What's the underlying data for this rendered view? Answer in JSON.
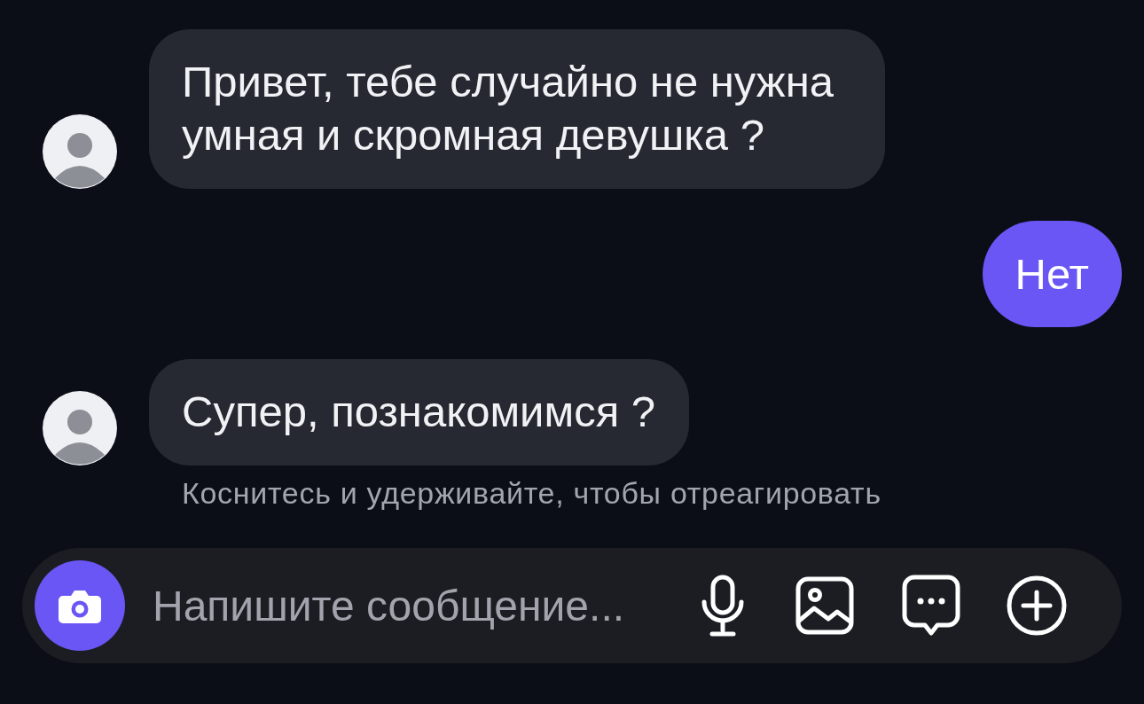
{
  "messages": [
    {
      "kind": "incoming",
      "text": "Привет, тебе случайно не нужна умная и скромная девушка ?"
    },
    {
      "kind": "outgoing",
      "text": "Нет"
    },
    {
      "kind": "incoming",
      "text": "Супер, познакомимся ?",
      "hint": "Коснитесь и удерживайте, чтобы отреагировать"
    }
  ],
  "composer": {
    "placeholder": "Напишите сообщение..."
  }
}
